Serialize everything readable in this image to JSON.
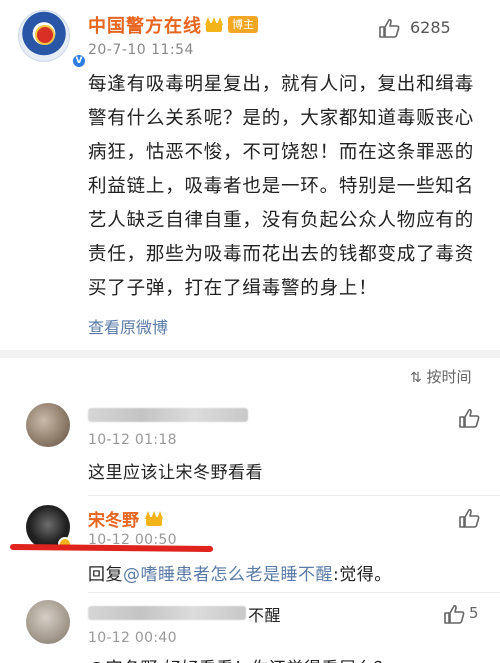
{
  "post": {
    "author": "中国警方在线",
    "tag": "博主",
    "date": "20-7-10 11:54",
    "like_count": "6285",
    "body": "每逢有吸毒明星复出，就有人问，复出和缉毒警有什么关系呢？是的，大家都知道毒贩丧心病狂，怙恶不悛，不可饶恕！而在这条罪恶的利益链上，吸毒者也是一环。特别是一些知名艺人缺乏自律自重，没有负起公众人物应有的责任，那些为吸毒而花出去的钱都变成了毒资买了子弹，打在了缉毒警的身上！",
    "view_original": "查看原微博"
  },
  "sort_label": "按时间",
  "comments": [
    {
      "date": "10-12 01:18",
      "text": "这里应该让宋冬野看看"
    },
    {
      "name": "宋冬野",
      "date": "10-12 00:50",
      "reply_prefix": "回复",
      "reply_user": "@嗜睡患者怎么老是睡不醒",
      "reply_text": ":觉得。"
    },
    {
      "name_suffix": "不醒",
      "date": "10-12 00:40",
      "text": "@宋冬野 好好看看！你还觉得看屁么？"
    }
  ],
  "colors": {
    "accent_orange": "#e8641f",
    "link_blue": "#5b7ca8",
    "annotation_red": "#e0231d"
  }
}
